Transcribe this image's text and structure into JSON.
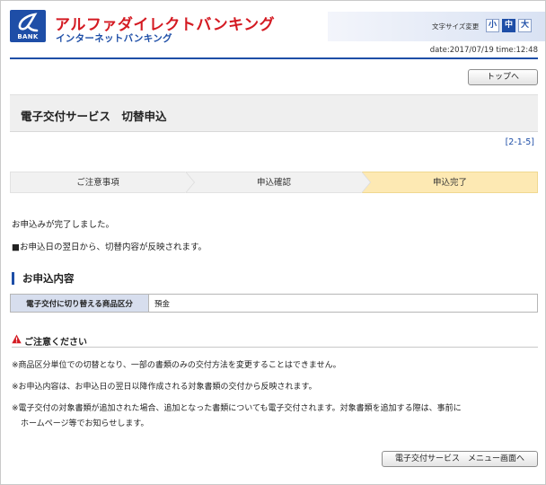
{
  "header": {
    "logo_text": "BANK",
    "brand_title": "アルファダイレクトバンキング",
    "brand_sub": "インターネットバンキング",
    "font_size_label": "文字サイズ変更",
    "font_sizes": [
      "小",
      "中",
      "大"
    ],
    "font_size_selected": "中",
    "date_time": "date:2017/07/19 time:12:48"
  },
  "nav": {
    "top_button": "トップへ"
  },
  "page": {
    "title": "電子交付サービス　切替申込",
    "screen_id": "[2-1-5]"
  },
  "steps": [
    "ご注意事項",
    "申込確認",
    "申込完了"
  ],
  "current_step": "申込完了",
  "messages": [
    "お申込みが完了しました。",
    "■お申込日の翌日から、切替内容が反映されます。"
  ],
  "section": {
    "heading": "お申込内容",
    "rows": [
      {
        "label": "電子交付に切り替える商品区分",
        "value": "預金"
      }
    ]
  },
  "caution": {
    "heading": "ご注意ください",
    "notes": [
      "※商品区分単位での切替となり、一部の書類のみの交付方法を変更することはできません。",
      "※お申込内容は、お申込日の翌日以降作成される対象書類の交付から反映されます。",
      "※電子交付の対象書類が追加された場合、追加となった書類についても電子交付されます。対象書類を追加する際は、事前に",
      "ホームページ等でお知らせします。"
    ]
  },
  "footer": {
    "menu_button": "電子交付サービス　メニュー画面へ"
  },
  "colors": {
    "brand_red": "#d41a22",
    "brand_blue": "#1e4ea7",
    "current_step_bg": "#fde9b3"
  }
}
